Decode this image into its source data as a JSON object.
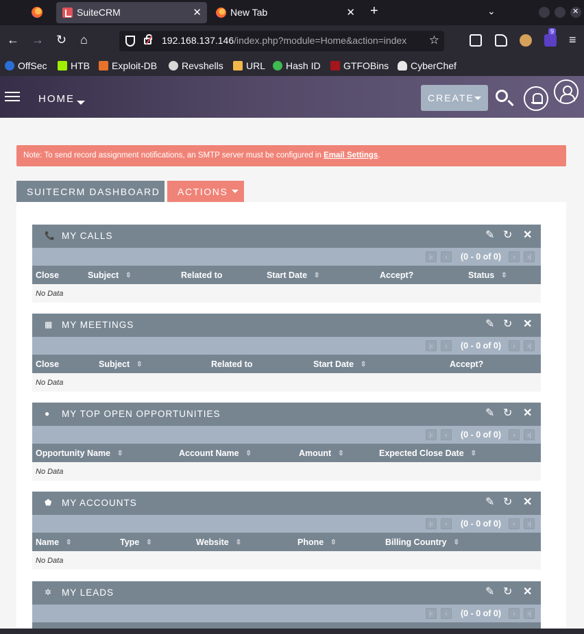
{
  "browser": {
    "tabs": [
      {
        "title": "SuiteCRM",
        "active": true
      },
      {
        "title": "New Tab",
        "active": false
      }
    ],
    "url_host": "192.168.137.146",
    "url_path": "/index.php?module=Home&action=index",
    "extension_badge": "9",
    "bookmarks": [
      "OffSec",
      "HTB",
      "Exploit-DB",
      "Revshells",
      "URL",
      "Hash ID",
      "GTFOBins",
      "CyberChef"
    ]
  },
  "crm": {
    "home_label": "HOME",
    "create_label": "CREATE",
    "notice_prefix": "Note: To send record assignment notifications, an SMTP server must be configured in ",
    "notice_link": "Email Settings",
    "notice_suffix": ".",
    "dashboard_tab": "SUITECRM DASHBOARD",
    "actions_label": "ACTIONS"
  },
  "dashlets": [
    {
      "title": "MY CALLS",
      "icon": "phone-icon",
      "pager": "(0 - 0 of 0)",
      "columns": [
        "Close",
        "Subject",
        "Related to",
        "Start Date",
        "Accept?",
        "Status"
      ],
      "empty": "No Data"
    },
    {
      "title": "MY MEETINGS",
      "icon": "calendar-icon",
      "pager": "(0 - 0 of 0)",
      "columns": [
        "Close",
        "Subject",
        "Related to",
        "Start Date",
        "Accept?"
      ],
      "empty": "No Data"
    },
    {
      "title": "MY TOP OPEN OPPORTUNITIES",
      "icon": "lightbulb-icon",
      "pager": "(0 - 0 of 0)",
      "columns": [
        "Opportunity Name",
        "Account Name",
        "Amount",
        "Expected Close Date"
      ],
      "empty": "No Data"
    },
    {
      "title": "MY ACCOUNTS",
      "icon": "shield-icon",
      "pager": "(0 - 0 of 0)",
      "columns": [
        "Name",
        "Type",
        "Website",
        "Phone",
        "Billing Country"
      ],
      "empty": "No Data"
    },
    {
      "title": "MY LEADS",
      "icon": "gear-icon",
      "pager": "(0 - 0 of 0)",
      "columns": [],
      "empty": ""
    }
  ]
}
